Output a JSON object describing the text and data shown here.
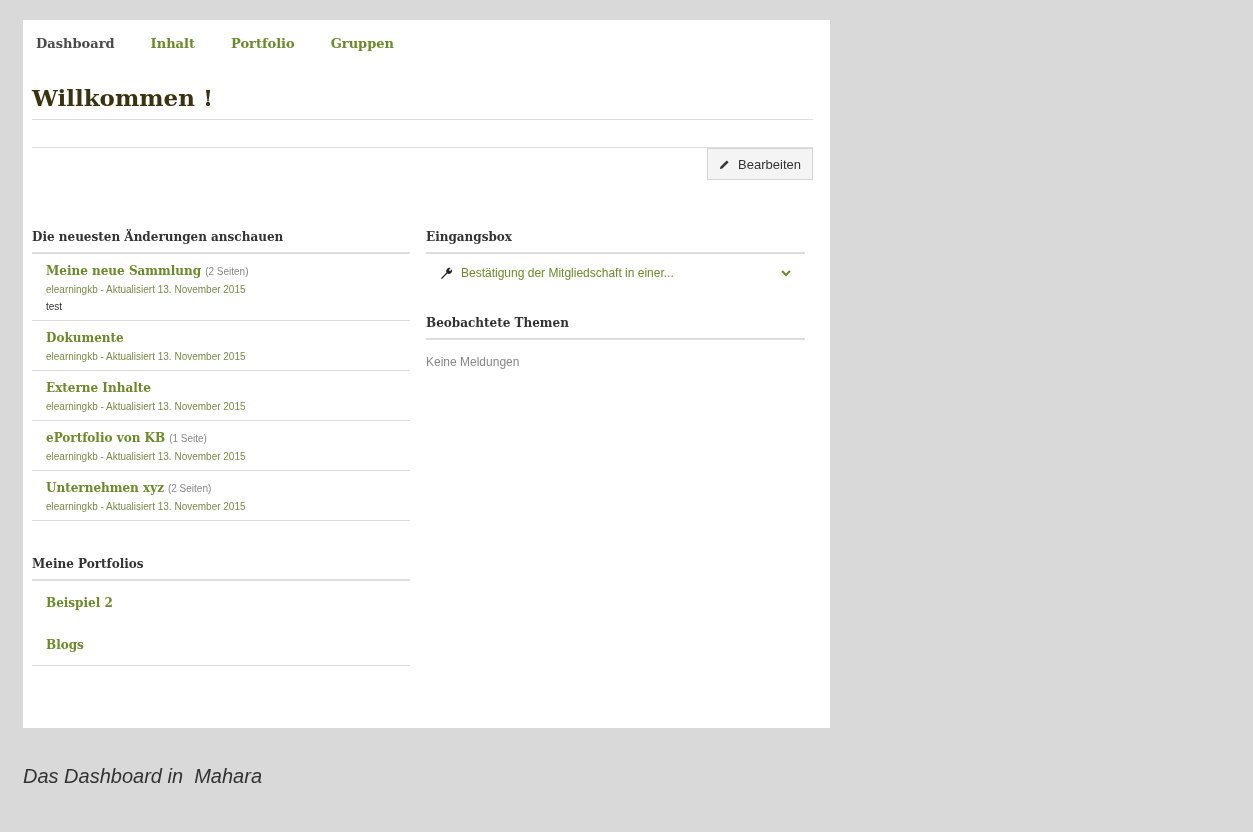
{
  "nav": [
    {
      "label": "Dashboard",
      "selected": true
    },
    {
      "label": "Inhalt",
      "selected": false
    },
    {
      "label": "Portfolio",
      "selected": false
    },
    {
      "label": "Gruppen",
      "selected": false
    }
  ],
  "title": "Willkommen !",
  "edit_button": "Bearbeiten",
  "recent": {
    "heading": "Die neuesten Änderungen anschauen",
    "items": [
      {
        "title": "Meine neue Sammlung",
        "pages": "(2 Seiten)",
        "meta": "elearningkb - Aktualisiert 13. November 2015",
        "description": "test"
      },
      {
        "title": "Dokumente",
        "meta": "elearningkb - Aktualisiert 13. November 2015"
      },
      {
        "title": "Externe Inhalte",
        "meta": "elearningkb - Aktualisiert 13. November 2015"
      },
      {
        "title": "ePortfolio von KB",
        "pages": "(1 Seite)",
        "meta": "elearningkb - Aktualisiert 13. November 2015"
      },
      {
        "title": "Unternehmen xyz",
        "pages": "(2 Seiten)",
        "meta": "elearningkb - Aktualisiert 13. November 2015"
      }
    ]
  },
  "portfolios": {
    "heading": "Meine Portfolios",
    "items": [
      "Beispiel 2",
      "Blogs"
    ]
  },
  "inbox": {
    "heading": "Eingangsbox",
    "items": [
      {
        "text": "Bestätigung der Mitgliedschaft in einer...",
        "expanded": false
      }
    ]
  },
  "watched": {
    "heading": "Beobachtete Themen",
    "empty": "Keine Meldungen"
  },
  "caption": "Das Dashboard in  Mahara"
}
